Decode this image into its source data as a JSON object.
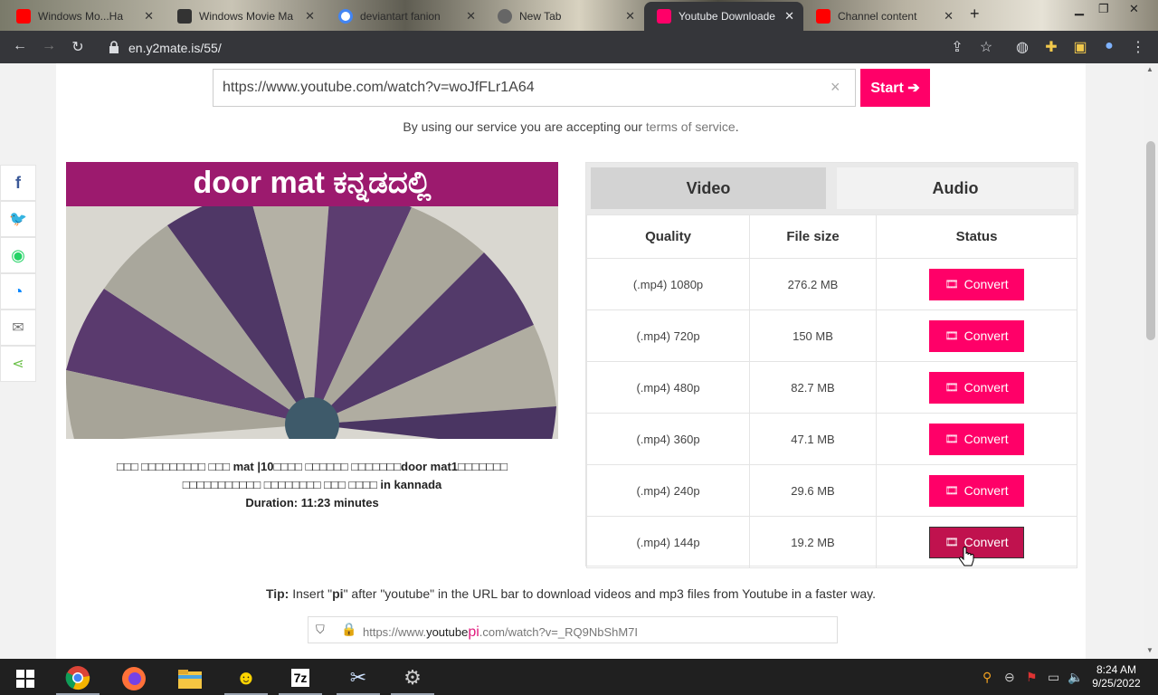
{
  "browser": {
    "tabs": [
      {
        "label": "Windows Mo...Ha",
        "favicon": "youtube-icon",
        "color": "#ff0000"
      },
      {
        "label": "Windows Movie Ma",
        "favicon": "museum-icon",
        "color": "#444444"
      },
      {
        "label": "deviantart fanion",
        "favicon": "google-icon",
        "color": "#4285f4"
      },
      {
        "label": "New Tab",
        "favicon": "chrome-icon",
        "color": "#777777"
      },
      {
        "label": "Youtube Downloade",
        "favicon": "download-icon",
        "color": "#ff0068"
      },
      {
        "label": "Channel content",
        "favicon": "youtube-icon",
        "color": "#ff0000"
      }
    ],
    "url": "en.y2mate.is/55/"
  },
  "search": {
    "value": "https://www.youtube.com/watch?v=woJfFLr1A64",
    "clear": "×",
    "start_label": "Start ➔"
  },
  "terms": {
    "prefix": "By using our service you are accepting our ",
    "link": "terms of service",
    "suffix": "."
  },
  "video": {
    "thumbnail_title": "door mat ಕನ್ನಡದಲ್ಲಿ",
    "title_line1_pre": "□□□ □□□□□□□□□ □□□ ",
    "title_line1_b1": "mat |10",
    "title_line1_mid": "□□□□ □□□□□□ □□□□□□□",
    "title_line1_b2": "door mat1",
    "title_line1_post": "□□□□□□□",
    "title_line2_pre": "□□□□□□□□□□□ □□□□□□□□ □□□ □□□□ ",
    "title_line2_b": "in kannada",
    "duration": "Duration: 11:23 minutes"
  },
  "panel": {
    "tab_video": "Video",
    "tab_audio": "Audio",
    "headers": [
      "Quality",
      "File size",
      "Status"
    ],
    "convert_label": "Convert",
    "rows": [
      {
        "quality": "(.mp4) 1080p",
        "size": "276.2 MB"
      },
      {
        "quality": "(.mp4) 720p",
        "size": "150 MB"
      },
      {
        "quality": "(.mp4) 480p",
        "size": "82.7 MB"
      },
      {
        "quality": "(.mp4) 360p",
        "size": "47.1 MB"
      },
      {
        "quality": "(.mp4) 240p",
        "size": "29.6 MB"
      },
      {
        "quality": "(.mp4) 144p",
        "size": "19.2 MB"
      }
    ]
  },
  "tip": {
    "label": "Tip:",
    "text_pre": " Insert \"",
    "pi": "pi",
    "text_post": "\" after \"youtube\" in the URL bar to download videos and mp3 files from Youtube in a faster way.",
    "example_pre": "https://www.",
    "example_youtube": "youtube",
    "example_pi": "pi",
    "example_post": ".com/watch?v=_RQ9NbShM7I"
  },
  "taskbar": {
    "time": "8:24 AM",
    "date": "9/25/2022"
  },
  "colors": {
    "accent": "#ff0068",
    "thumb_header": "#9c1a6e"
  }
}
